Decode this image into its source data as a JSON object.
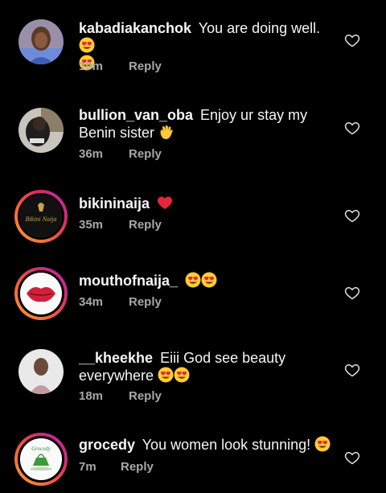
{
  "comments": [
    {
      "username": "kabadiakanchok",
      "text": "You are doing well.",
      "time": "19m",
      "reply_label": "Reply",
      "emoji": [
        "heart-eyes-emoji",
        "heart-eyes-emoji"
      ],
      "story_ring": false
    },
    {
      "username": "bullion_van_oba",
      "text": "Enjoy ur stay my Benin sister",
      "time": "36m",
      "reply_label": "Reply",
      "emoji": [
        "waving-hand-emoji"
      ],
      "story_ring": false
    },
    {
      "username": "bikininaija",
      "text": "",
      "time": "35m",
      "reply_label": "Reply",
      "emoji": [
        "red-heart-emoji"
      ],
      "story_ring": true
    },
    {
      "username": "mouthofnaija_",
      "text": "",
      "time": "34m",
      "reply_label": "Reply",
      "emoji": [
        "heart-eyes-emoji",
        "heart-eyes-emoji"
      ],
      "story_ring": true
    },
    {
      "username": "__kheekhe",
      "text": "Eiii God see beauty everywhere",
      "time": "18m",
      "reply_label": "Reply",
      "emoji": [
        "heart-eyes-emoji",
        "heart-eyes-emoji"
      ],
      "story_ring": false
    },
    {
      "username": "grocedy",
      "text": "You women look stunning!",
      "time": "7m",
      "reply_label": "Reply",
      "emoji": [
        "heart-eyes-emoji"
      ],
      "story_ring": true
    }
  ],
  "avatar_labels": {
    "bikininaija": "Bikini Naija",
    "grocedy": "Grocedy"
  },
  "colors": {
    "background": "#000000",
    "text": "#f5f5f5",
    "meta": "#a8a8a8",
    "story_ring_start": "#f9a13a",
    "story_ring_end": "#b22bb8",
    "heart": "#e8253b"
  }
}
